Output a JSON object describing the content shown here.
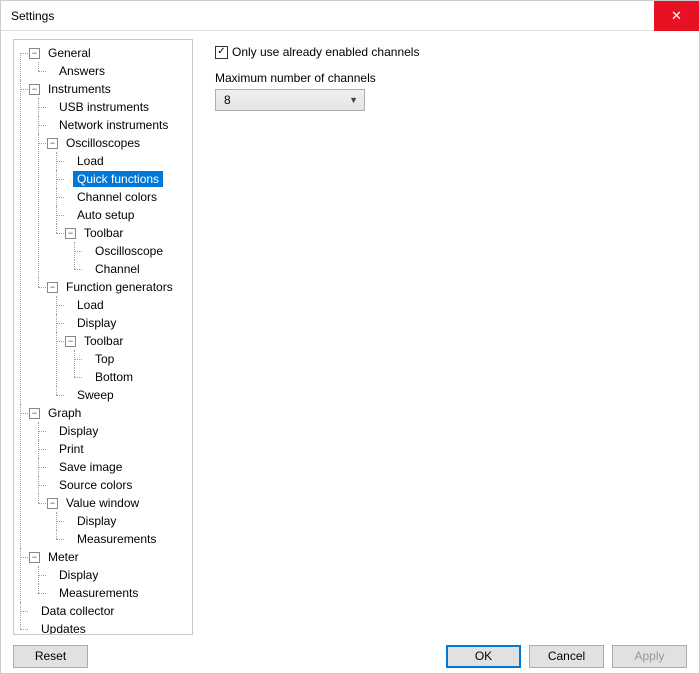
{
  "window": {
    "title": "Settings"
  },
  "tree": {
    "general": "General",
    "answers": "Answers",
    "instruments": "Instruments",
    "usb_instruments": "USB instruments",
    "network_instruments": "Network instruments",
    "oscilloscopes": "Oscilloscopes",
    "osc_load": "Load",
    "osc_quick_functions": "Quick functions",
    "osc_channel_colors": "Channel colors",
    "osc_auto_setup": "Auto setup",
    "osc_toolbar": "Toolbar",
    "osc_tb_oscilloscope": "Oscilloscope",
    "osc_tb_channel": "Channel",
    "function_generators": "Function generators",
    "fg_load": "Load",
    "fg_display": "Display",
    "fg_toolbar": "Toolbar",
    "fg_tb_top": "Top",
    "fg_tb_bottom": "Bottom",
    "fg_sweep": "Sweep",
    "graph": "Graph",
    "gr_display": "Display",
    "gr_print": "Print",
    "gr_save_image": "Save image",
    "gr_source_colors": "Source colors",
    "gr_value_window": "Value window",
    "gr_vw_display": "Display",
    "gr_vw_measurements": "Measurements",
    "meter": "Meter",
    "mt_display": "Display",
    "mt_measurements": "Measurements",
    "data_collector": "Data collector",
    "updates": "Updates"
  },
  "panel": {
    "only_enabled_label": "Only use already enabled channels",
    "only_enabled_checked": true,
    "max_channels_label": "Maximum number of channels",
    "max_channels_value": "8"
  },
  "buttons": {
    "reset": "Reset",
    "ok": "OK",
    "cancel": "Cancel",
    "apply": "Apply"
  }
}
